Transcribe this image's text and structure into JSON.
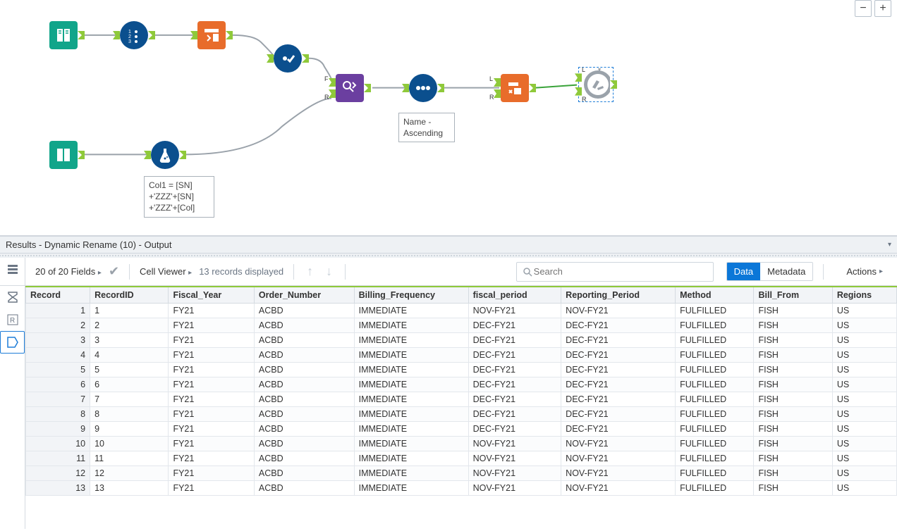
{
  "canvas": {
    "zoom_minus": "−",
    "zoom_plus": "+",
    "sort_annotation": "Name -\nAscending",
    "formula_annotation": "Col1 = [SN]\n+'ZZZ'+[SN]\n+'ZZZ'+[Col]",
    "port_labels": {
      "F": "F",
      "R": "R",
      "L": "L"
    },
    "tools": {
      "input1": {
        "name": "input-tool",
        "shape": "square",
        "color": "teal",
        "icon": "book"
      },
      "recordid": {
        "name": "record-id-tool",
        "shape": "circle",
        "color": "navy",
        "icon": "123"
      },
      "select": {
        "name": "select-tool",
        "shape": "square",
        "color": "orange",
        "icon": "select"
      },
      "cleanse": {
        "name": "data-cleanse-tool",
        "shape": "circle",
        "color": "navy",
        "icon": "check"
      },
      "findreplace": {
        "name": "find-replace-tool",
        "shape": "square",
        "color": "purple",
        "icon": "pencil"
      },
      "sort": {
        "name": "sort-tool",
        "shape": "circle",
        "color": "navy",
        "icon": "dots"
      },
      "rename": {
        "name": "dynamic-rename-tool",
        "shape": "square",
        "color": "orange",
        "icon": "rename"
      },
      "output": {
        "name": "output-tool",
        "shape": "circle",
        "color": "saw",
        "icon": "saw"
      },
      "input2": {
        "name": "input-tool-2",
        "shape": "square",
        "color": "teal",
        "icon": "book"
      },
      "formula": {
        "name": "formula-tool",
        "shape": "circle",
        "color": "navy",
        "icon": "flask"
      }
    }
  },
  "results": {
    "title": "Results - Dynamic Rename (10) - Output",
    "fields_label": "20 of 20 Fields",
    "cell_viewer": "Cell Viewer",
    "records_label": "13 records displayed",
    "search_placeholder": "Search",
    "tab_data": "Data",
    "tab_metadata": "Metadata",
    "actions": "Actions"
  },
  "columns": [
    "Record",
    "RecordID",
    "Fiscal_Year",
    "Order_Number",
    "Billing_Frequency",
    "fiscal_period",
    "Reporting_Period",
    "Method",
    "Bill_From",
    "Regions"
  ],
  "rows": [
    {
      "rec": "1",
      "RecordID": "1",
      "Fiscal_Year": "FY21",
      "Order_Number": "ACBD",
      "Billing_Frequency": "IMMEDIATE",
      "fiscal_period": "NOV-FY21",
      "Reporting_Period": "NOV-FY21",
      "Method": "FULFILLED",
      "Bill_From": "FISH",
      "Regions": "US"
    },
    {
      "rec": "2",
      "RecordID": "2",
      "Fiscal_Year": "FY21",
      "Order_Number": "ACBD",
      "Billing_Frequency": "IMMEDIATE",
      "fiscal_period": "DEC-FY21",
      "Reporting_Period": "DEC-FY21",
      "Method": "FULFILLED",
      "Bill_From": "FISH",
      "Regions": "US"
    },
    {
      "rec": "3",
      "RecordID": "3",
      "Fiscal_Year": "FY21",
      "Order_Number": "ACBD",
      "Billing_Frequency": "IMMEDIATE",
      "fiscal_period": "DEC-FY21",
      "Reporting_Period": "DEC-FY21",
      "Method": "FULFILLED",
      "Bill_From": "FISH",
      "Regions": "US"
    },
    {
      "rec": "4",
      "RecordID": "4",
      "Fiscal_Year": "FY21",
      "Order_Number": "ACBD",
      "Billing_Frequency": "IMMEDIATE",
      "fiscal_period": "DEC-FY21",
      "Reporting_Period": "DEC-FY21",
      "Method": "FULFILLED",
      "Bill_From": "FISH",
      "Regions": "US"
    },
    {
      "rec": "5",
      "RecordID": "5",
      "Fiscal_Year": "FY21",
      "Order_Number": "ACBD",
      "Billing_Frequency": "IMMEDIATE",
      "fiscal_period": "DEC-FY21",
      "Reporting_Period": "DEC-FY21",
      "Method": "FULFILLED",
      "Bill_From": "FISH",
      "Regions": "US"
    },
    {
      "rec": "6",
      "RecordID": "6",
      "Fiscal_Year": "FY21",
      "Order_Number": "ACBD",
      "Billing_Frequency": "IMMEDIATE",
      "fiscal_period": "DEC-FY21",
      "Reporting_Period": "DEC-FY21",
      "Method": "FULFILLED",
      "Bill_From": "FISH",
      "Regions": "US"
    },
    {
      "rec": "7",
      "RecordID": "7",
      "Fiscal_Year": "FY21",
      "Order_Number": "ACBD",
      "Billing_Frequency": "IMMEDIATE",
      "fiscal_period": "DEC-FY21",
      "Reporting_Period": "DEC-FY21",
      "Method": "FULFILLED",
      "Bill_From": "FISH",
      "Regions": "US"
    },
    {
      "rec": "8",
      "RecordID": "8",
      "Fiscal_Year": "FY21",
      "Order_Number": "ACBD",
      "Billing_Frequency": "IMMEDIATE",
      "fiscal_period": "DEC-FY21",
      "Reporting_Period": "DEC-FY21",
      "Method": "FULFILLED",
      "Bill_From": "FISH",
      "Regions": "US"
    },
    {
      "rec": "9",
      "RecordID": "9",
      "Fiscal_Year": "FY21",
      "Order_Number": "ACBD",
      "Billing_Frequency": "IMMEDIATE",
      "fiscal_period": "DEC-FY21",
      "Reporting_Period": "DEC-FY21",
      "Method": "FULFILLED",
      "Bill_From": "FISH",
      "Regions": "US"
    },
    {
      "rec": "10",
      "RecordID": "10",
      "Fiscal_Year": "FY21",
      "Order_Number": "ACBD",
      "Billing_Frequency": "IMMEDIATE",
      "fiscal_period": "NOV-FY21",
      "Reporting_Period": "NOV-FY21",
      "Method": "FULFILLED",
      "Bill_From": "FISH",
      "Regions": "US"
    },
    {
      "rec": "11",
      "RecordID": "11",
      "Fiscal_Year": "FY21",
      "Order_Number": "ACBD",
      "Billing_Frequency": "IMMEDIATE",
      "fiscal_period": "NOV-FY21",
      "Reporting_Period": "NOV-FY21",
      "Method": "FULFILLED",
      "Bill_From": "FISH",
      "Regions": "US"
    },
    {
      "rec": "12",
      "RecordID": "12",
      "Fiscal_Year": "FY21",
      "Order_Number": "ACBD",
      "Billing_Frequency": "IMMEDIATE",
      "fiscal_period": "NOV-FY21",
      "Reporting_Period": "NOV-FY21",
      "Method": "FULFILLED",
      "Bill_From": "FISH",
      "Regions": "US"
    },
    {
      "rec": "13",
      "RecordID": "13",
      "Fiscal_Year": "FY21",
      "Order_Number": "ACBD",
      "Billing_Frequency": "IMMEDIATE",
      "fiscal_period": "NOV-FY21",
      "Reporting_Period": "NOV-FY21",
      "Method": "FULFILLED",
      "Bill_From": "FISH",
      "Regions": "US"
    }
  ]
}
